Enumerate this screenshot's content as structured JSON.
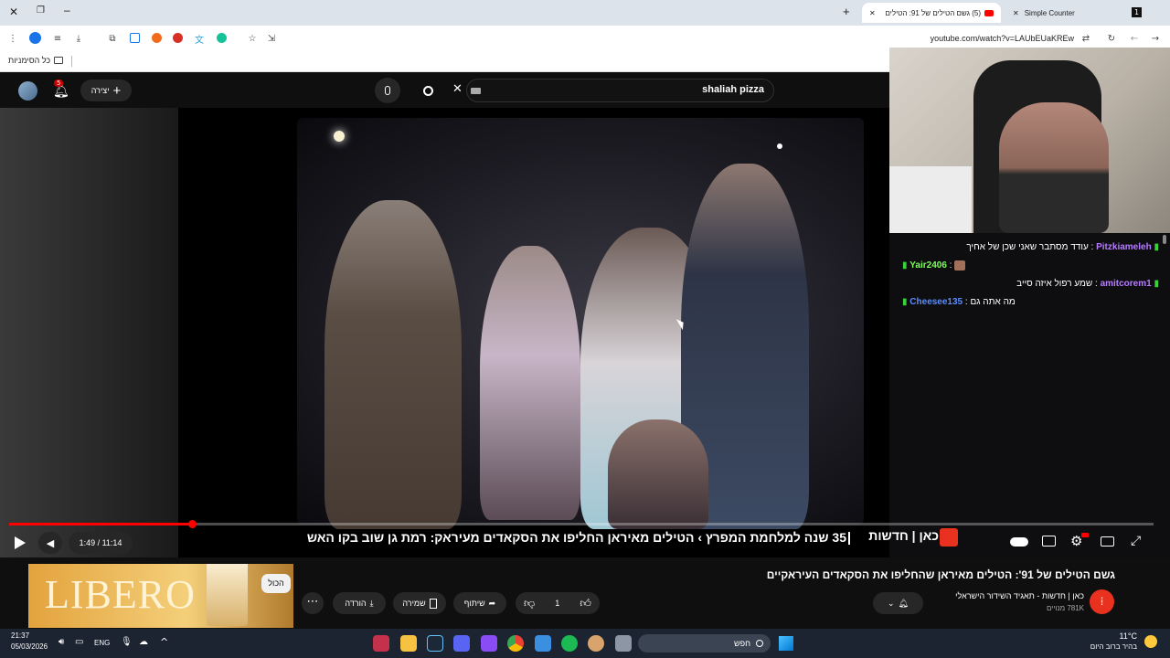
{
  "browser": {
    "tabs": [
      {
        "title": "Simple Counter"
      },
      {
        "title": "(5) גשם הטילים של 91: הטילים"
      }
    ],
    "url": "youtube.com/watch?v=LAUbEUaKREw",
    "bookmarks_label": "כל הסימניות"
  },
  "youtube": {
    "notif_count": "5",
    "create_label": "יצירה",
    "search_query": "shaliah pizza",
    "player": {
      "time": "1:49 / 11:14",
      "progress": 0.16,
      "ticker": "35 שנה למלחמת המפרץ  ›  הטילים מאיראן החליפו את הסקאדים מעיראק: רמת גן שוב בקו האש",
      "channel_tag": "כאן | חדשות"
    },
    "video_title": "גשם הטילים של 91': הטילים מאיראן שהחליפו את הסקאדים העיראקיים",
    "channel_name": "כאן | חדשות - תאגיד השידור הישראלי",
    "subscribers": "781K מנויים",
    "like_count": "1",
    "actions": {
      "share": "שיתוף",
      "save": "שמירה",
      "download": "הורדה"
    },
    "all_chip": "הכול",
    "ad_text": "LIBERO"
  },
  "chat": {
    "messages": [
      {
        "user": "Pitzkiameleh",
        "text": "עודד מסתבר שאני שכן של אחיך",
        "color": "#b67cff"
      },
      {
        "user": "Yair2406",
        "text": "",
        "color": "#7cff5a"
      },
      {
        "user": "amitcorem1",
        "text": "שמע רפול איזה סייב",
        "color": "#b67cff"
      },
      {
        "user": "Cheesee135",
        "text": "מה אתה גם",
        "color": "#5a8cff"
      }
    ]
  },
  "taskbar": {
    "time": "21:37",
    "date": "05/03/2026",
    "lang": "ENG",
    "search": "חפש",
    "weather_temp": "11°C",
    "weather_desc": "בהיר ברוב היום"
  }
}
